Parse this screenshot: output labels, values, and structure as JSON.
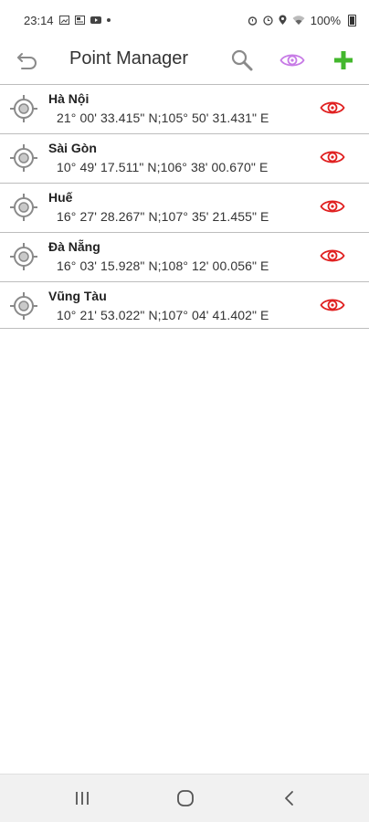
{
  "status_bar": {
    "time": "23:14",
    "battery": "100%"
  },
  "toolbar": {
    "title": "Point Manager",
    "back_icon": "undo-arrow-icon",
    "search_icon": "search-icon",
    "eye_icon": "eye-icon",
    "add_icon": "plus-icon"
  },
  "points": [
    {
      "name": "Hà Nội",
      "coords": "21° 00' 33.415\" N;105° 50' 31.431\" E"
    },
    {
      "name": "Sài Gòn",
      "coords": "10° 49' 17.511\" N;106° 38' 00.670\" E"
    },
    {
      "name": "Huế",
      "coords": "16° 27' 28.267\" N;107° 35' 21.455\" E"
    },
    {
      "name": "Đà Nẵng",
      "coords": "16° 03' 15.928\" N;108° 12' 00.056\" E"
    },
    {
      "name": "Vũng Tàu",
      "coords": "10° 21' 53.022\" N;107° 04' 41.402\" E"
    }
  ],
  "colors": {
    "accent_eye_toolbar": "#c77be6",
    "eye_item": "#e02020",
    "add": "#43b72d",
    "icon_gray": "#8a8a8a"
  }
}
